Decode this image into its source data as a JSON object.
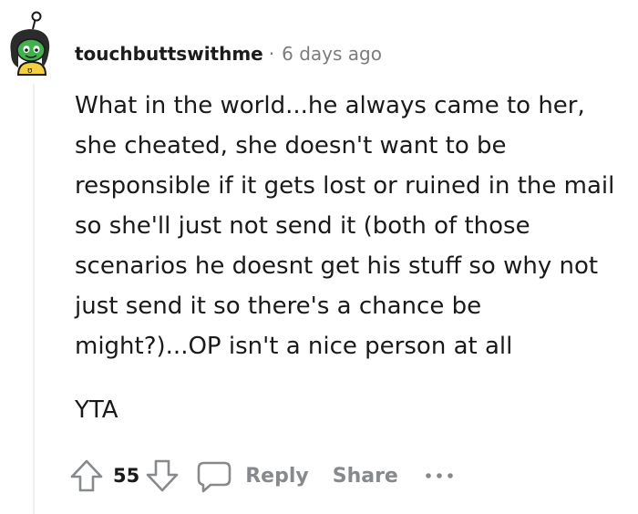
{
  "comment": {
    "username": "touchbuttswithme",
    "separator": "·",
    "timestamp": "6 days ago",
    "body": "What in the world...he always came to her, she cheated, she doesn't want to be responsible if it gets lost or ruined in the mail so she'll just not send it (both of those scenarios he doesnt get his stuff so why not just send it so there's a chance be might?)...OP isn't a nice person at all",
    "verdict": "YTA",
    "vote_count": "55"
  },
  "actions": {
    "reply_label": "Reply",
    "share_label": "Share"
  },
  "icons": {
    "avatar": "snoo-avatar",
    "upvote": "arrow-up-outline-icon",
    "downvote": "arrow-down-outline-icon",
    "comment": "speech-bubble-icon",
    "more": "ellipsis-icon"
  },
  "colors": {
    "text_primary": "#1a1a1b",
    "text_meta": "#7c7c7c",
    "avatar_green": "#3fb24b",
    "avatar_yellow": "#f4d03f"
  }
}
